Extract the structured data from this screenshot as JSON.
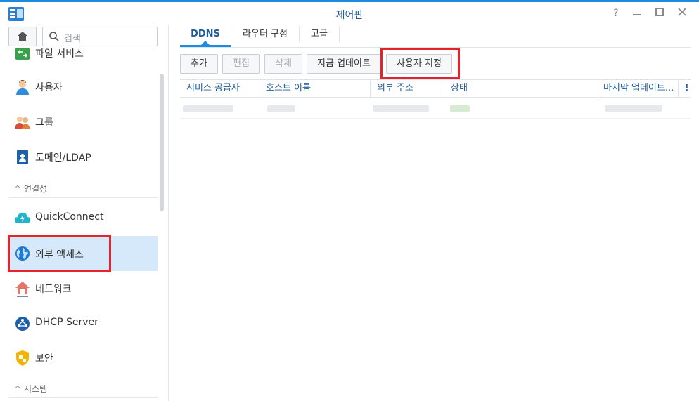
{
  "window": {
    "title": "제어판",
    "help_icon": "help-icon",
    "minimize_icon": "minimize-icon",
    "maximize_icon": "maximize-icon",
    "close_icon": "close-icon"
  },
  "sidebar": {
    "search_placeholder": "검색",
    "items": [
      {
        "label": "파일 서비스",
        "icon": "file-services-icon"
      },
      {
        "label": "사용자",
        "icon": "user-icon"
      },
      {
        "label": "그룹",
        "icon": "group-icon"
      },
      {
        "label": "도메인/LDAP",
        "icon": "domain-ldap-icon"
      },
      {
        "label": "QuickConnect",
        "icon": "quickconnect-icon"
      },
      {
        "label": "외부 액세스",
        "icon": "external-access-icon"
      },
      {
        "label": "네트워크",
        "icon": "network-icon"
      },
      {
        "label": "DHCP Server",
        "icon": "dhcp-server-icon"
      },
      {
        "label": "보안",
        "icon": "security-icon"
      }
    ],
    "sections": {
      "connectivity": "연결성",
      "system": "시스템"
    }
  },
  "tabs": [
    {
      "label": "DDNS"
    },
    {
      "label": "라우터 구성"
    },
    {
      "label": "고급"
    }
  ],
  "toolbar": {
    "add": "추가",
    "edit": "편집",
    "delete": "삭제",
    "update_now": "지금 업데이트",
    "customize": "사용자 지정"
  },
  "grid": {
    "columns": [
      "서비스 공급자",
      "호스트 이름",
      "외부 주소",
      "상태",
      "마지막 업데이트..."
    ]
  },
  "colors": {
    "accent": "#1a8be0",
    "highlight": "#e5232a",
    "selected": "#d6e9fb",
    "header_text": "#1f5c99"
  }
}
